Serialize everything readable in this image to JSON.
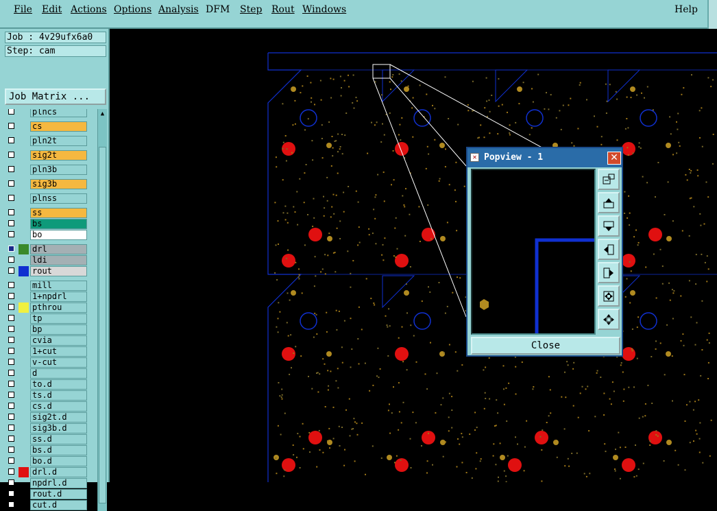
{
  "menubar": {
    "items": [
      {
        "label": "File"
      },
      {
        "label": "Edit"
      },
      {
        "label": "Actions"
      },
      {
        "label": "Options"
      },
      {
        "label": "Analysis"
      },
      {
        "label": "DFM"
      },
      {
        "label": "Step"
      },
      {
        "label": "Rout"
      },
      {
        "label": "Windows"
      }
    ],
    "help_label": "Help"
  },
  "job": {
    "line": "Job : 4v29ufx6a0"
  },
  "step": {
    "line": "Step: cam"
  },
  "job_matrix_button": "Job Matrix ...",
  "layers": [
    {
      "name": "plncs",
      "bg": "#96d4d4",
      "color": ""
    },
    {
      "name": "cs",
      "bg": "#f5b840",
      "color": ""
    },
    {
      "name": "pln2t",
      "bg": "#96d4d4",
      "color": ""
    },
    {
      "name": "sig2t",
      "bg": "#f5b840",
      "color": ""
    },
    {
      "name": "pln3b",
      "bg": "#96d4d4",
      "color": ""
    },
    {
      "name": "sig3b",
      "bg": "#f5b840",
      "color": ""
    },
    {
      "name": "plnss",
      "bg": "#96d4d4",
      "color": ""
    },
    {
      "name": "ss",
      "bg": "#f5b840",
      "color": ""
    },
    {
      "name": "bs",
      "bg": "#0e9a7a",
      "color": ""
    },
    {
      "name": "bo",
      "bg": "#ffffff",
      "color": ""
    },
    {
      "name": "drl",
      "bg": "#a4b0b4",
      "color": "#3a8a2a",
      "checked": true
    },
    {
      "name": "ldi",
      "bg": "#a4b0b4",
      "color": ""
    },
    {
      "name": "rout",
      "bg": "#d8d8d8",
      "color": "#1030d0"
    },
    {
      "name": "mill",
      "bg": "#96d4d4",
      "color": ""
    },
    {
      "name": "1+npdrl",
      "bg": "#96d4d4",
      "color": ""
    },
    {
      "name": "pthrou",
      "bg": "#96d4d4",
      "color": "#f0f040"
    },
    {
      "name": "tp",
      "bg": "#96d4d4",
      "color": ""
    },
    {
      "name": "bp",
      "bg": "#96d4d4",
      "color": ""
    },
    {
      "name": "cvia",
      "bg": "#96d4d4",
      "color": ""
    },
    {
      "name": "1+cut",
      "bg": "#96d4d4",
      "color": ""
    },
    {
      "name": "v-cut",
      "bg": "#96d4d4",
      "color": ""
    },
    {
      "name": "d",
      "bg": "#96d4d4",
      "color": ""
    },
    {
      "name": "to.d",
      "bg": "#96d4d4",
      "color": ""
    },
    {
      "name": "ts.d",
      "bg": "#96d4d4",
      "color": ""
    },
    {
      "name": "cs.d",
      "bg": "#96d4d4",
      "color": ""
    },
    {
      "name": "sig2t.d",
      "bg": "#96d4d4",
      "color": ""
    },
    {
      "name": "sig3b.d",
      "bg": "#96d4d4",
      "color": ""
    },
    {
      "name": "ss.d",
      "bg": "#96d4d4",
      "color": ""
    },
    {
      "name": "bs.d",
      "bg": "#96d4d4",
      "color": ""
    },
    {
      "name": "bo.d",
      "bg": "#96d4d4",
      "color": ""
    },
    {
      "name": "drl.d",
      "bg": "#96d4d4",
      "color": "#e01010"
    },
    {
      "name": "npdrl.d",
      "bg": "#96d4d4",
      "color": ""
    },
    {
      "name": "rout.d",
      "bg": "#96d4d4",
      "color": ""
    },
    {
      "name": "cut.d",
      "bg": "#96d4d4",
      "color": ""
    }
  ],
  "popview": {
    "title": "Popview - 1",
    "close_label": "Close"
  },
  "colors": {
    "menu_bg": "#96d4d4",
    "board_outline": "#1030d0",
    "drill_hole": "#e01010",
    "pad": "#b08a20",
    "title_bar": "#2a6ca8"
  }
}
